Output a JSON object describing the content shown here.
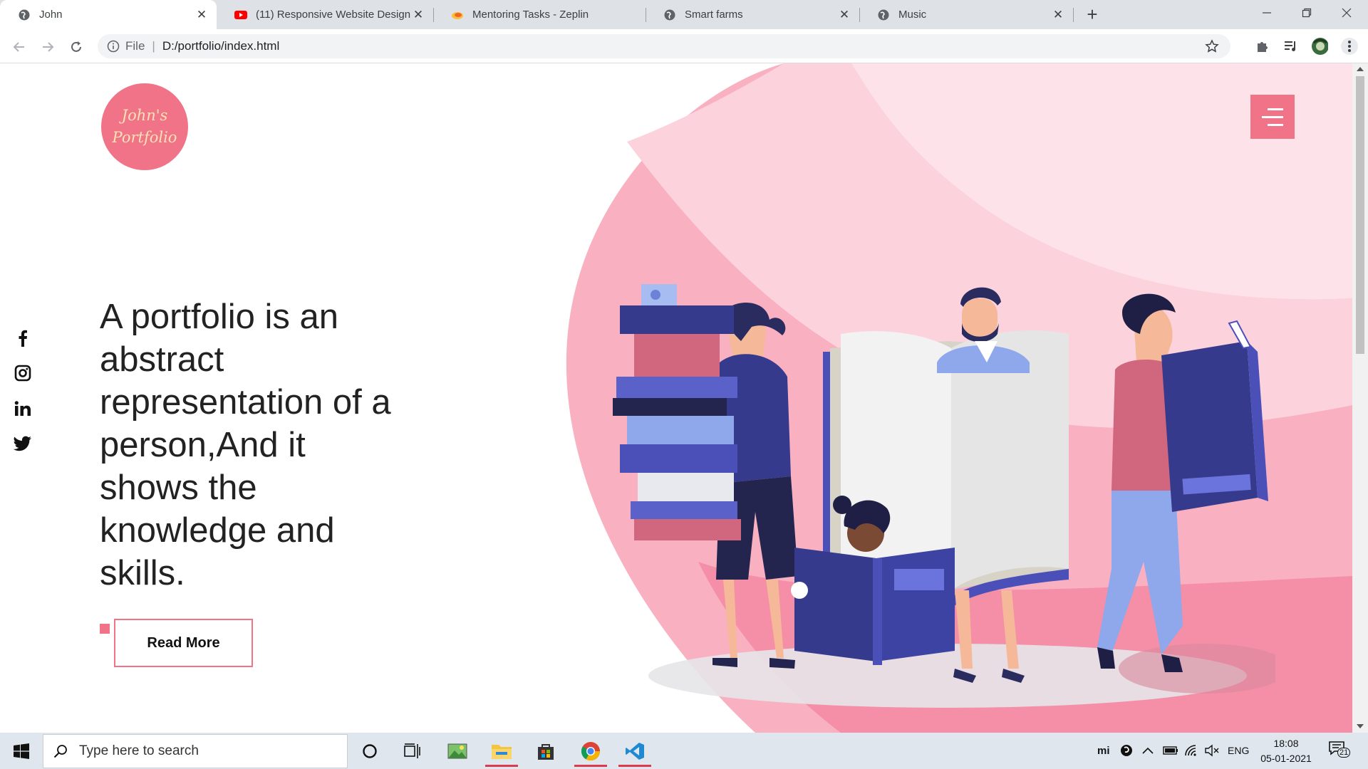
{
  "browser": {
    "tabs": [
      {
        "title": "John",
        "favicon": "globe-icon",
        "active": true
      },
      {
        "title": "(11) Responsive Website Design -",
        "favicon": "youtube-icon",
        "active": false
      },
      {
        "title": "Mentoring Tasks - Zeplin",
        "favicon": "zeplin-icon",
        "active": false
      },
      {
        "title": "Smart farms",
        "favicon": "globe-icon",
        "active": false
      },
      {
        "title": "Music",
        "favicon": "globe-icon",
        "active": false
      }
    ],
    "address": {
      "scheme_label": "File",
      "url": "D:/portfolio/index.html"
    }
  },
  "page": {
    "logo": {
      "line1": "John's",
      "line2": "Portfolio"
    },
    "headline": "A portfolio is an abstract representation of a person,And it shows the knowledge and skills.",
    "read_more_label": "Read More",
    "social": [
      "facebook-icon",
      "instagram-icon",
      "linkedin-icon",
      "twitter-icon"
    ],
    "colors": {
      "accent": "#f07388",
      "blob_light": "#fcd3dc",
      "blob_mid": "#f9b0c1",
      "blob_dark": "#f58ea7",
      "book_navy": "#353a8c"
    }
  },
  "taskbar": {
    "search_placeholder": "Type here to search",
    "lang": "ENG",
    "time": "18:08",
    "date": "05-01-2021",
    "notifications": "21"
  }
}
